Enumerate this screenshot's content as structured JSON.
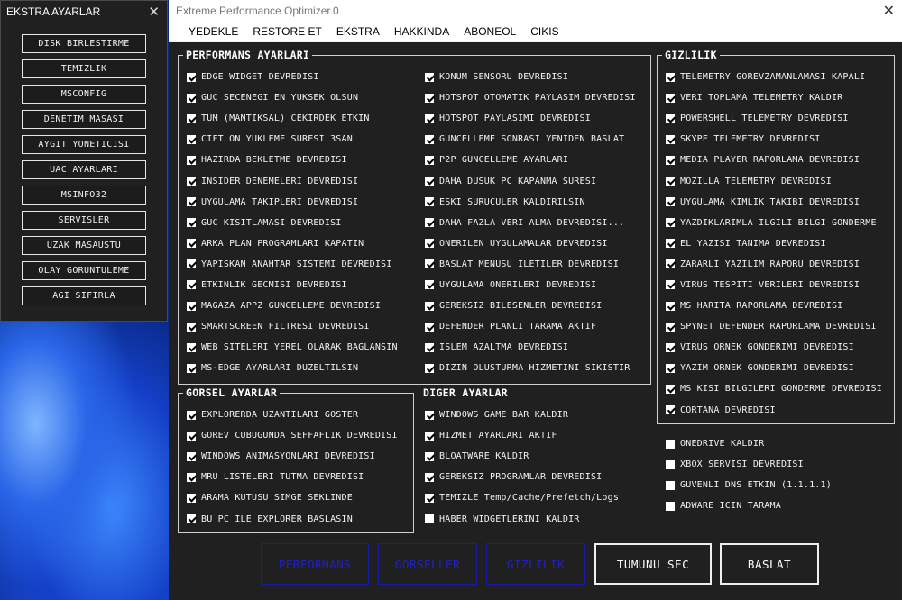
{
  "side_window": {
    "title": "EKSTRA AYARLAR",
    "close": "✕",
    "buttons": [
      "DISK BIRLESTIRME",
      "TEMIZLIK",
      "MSCONFIG",
      "DENETIM MASASI",
      "AYGIT YONETICISI",
      "UAC AYARLARI",
      "MSINFO32",
      "SERVISLER",
      "UZAK MASAUSTU",
      "OLAY GORUNTULEME",
      "AGI SIFIRLA"
    ]
  },
  "main_window": {
    "title": "Extreme Performance Optimizer.0",
    "close": "✕",
    "menu": [
      "YEDEKLE",
      "RESTORE ET",
      "EKSTRA",
      "HAKKINDA",
      "ABONEOL",
      "CIKIS"
    ]
  },
  "performans": {
    "title": "PERFORMANS AYARLARI",
    "col1": [
      {
        "label": "EDGE WIDGET DEVREDISI",
        "checked": true
      },
      {
        "label": "GUC SECENEGI EN YUKSEK OLSUN",
        "checked": true
      },
      {
        "label": "TUM (MANTIKSAL) CEKIRDEK ETKIN",
        "checked": true
      },
      {
        "label": "CIFT ON YUKLEME SURESI 3SAN",
        "checked": true
      },
      {
        "label": "HAZIRDA BEKLETME DEVREDISI",
        "checked": true
      },
      {
        "label": "INSIDER DENEMELERI DEVREDISI",
        "checked": true
      },
      {
        "label": "UYGULAMA TAKIPLERI DEVREDISI",
        "checked": true
      },
      {
        "label": "GUC KISITLAMASI DEVREDISI",
        "checked": true
      },
      {
        "label": "ARKA PLAN PROGRAMLARI KAPATIN",
        "checked": true
      },
      {
        "label": "YAPISKAN ANAHTAR SISTEMI DEVREDISI",
        "checked": true
      },
      {
        "label": "ETKINLIK GECMISI DEVREDISI",
        "checked": true
      },
      {
        "label": "MAGAZA APPZ GUNCELLEME DEVREDISI",
        "checked": true
      },
      {
        "label": "SMARTSCREEN FILTRESI DEVREDISI",
        "checked": true
      },
      {
        "label": "WEB SITELERI YEREL OLARAK BAGLANSIN",
        "checked": true
      },
      {
        "label": "MS-EDGE AYARLARI DUZELTILSIN",
        "checked": true
      }
    ],
    "col2": [
      {
        "label": "KONUM SENSORU DEVREDISI",
        "checked": true
      },
      {
        "label": "HOTSPOT OTOMATIK PAYLASIM DEVREDISI",
        "checked": true
      },
      {
        "label": "HOTSPOT PAYLASIMI DEVREDISI",
        "checked": true
      },
      {
        "label": "GUNCELLEME SONRASI YENIDEN BASLAT",
        "checked": true
      },
      {
        "label": "P2P GUNCELLEME AYARLARI",
        "checked": true
      },
      {
        "label": "DAHA DUSUK PC KAPANMA SURESI",
        "checked": true
      },
      {
        "label": "ESKI SURUCULER KALDIRILSIN",
        "checked": true
      },
      {
        "label": "DAHA FAZLA VERI ALMA DEVREDISI...",
        "checked": true
      },
      {
        "label": "ONERILEN UYGULAMALAR DEVREDISI",
        "checked": true
      },
      {
        "label": "BASLAT MENUSU ILETILER DEVREDISI",
        "checked": true
      },
      {
        "label": "UYGULAMA ONERILERI DEVREDISI",
        "checked": true
      },
      {
        "label": "GEREKSIZ BILESENLER DEVREDISI",
        "checked": true
      },
      {
        "label": "DEFENDER PLANLI TARAMA AKTIF",
        "checked": true
      },
      {
        "label": "ISLEM AZALTMA DEVREDISI",
        "checked": true
      },
      {
        "label": "DIZIN OLUSTURMA HIZMETINI SIKISTIR",
        "checked": true
      }
    ]
  },
  "gorsel": {
    "title": "GORSEL AYARLAR",
    "items": [
      {
        "label": "EXPLORERDA UZANTILARI GOSTER",
        "checked": true
      },
      {
        "label": "GOREV CUBUGUNDA SEFFAFLIK DEVREDISI",
        "checked": true
      },
      {
        "label": "WINDOWS ANIMASYONLARI DEVREDISI",
        "checked": true
      },
      {
        "label": "MRU LISTELERI TUTMA DEVREDISI",
        "checked": true
      },
      {
        "label": "ARAMA KUTUSU SIMGE SEKLINDE",
        "checked": true
      },
      {
        "label": "BU PC ILE EXPLORER BASLASIN",
        "checked": true
      }
    ]
  },
  "diger": {
    "title": "DIGER AYARLAR",
    "items": [
      {
        "label": "WINDOWS GAME BAR KALDIR",
        "checked": true
      },
      {
        "label": "HIZMET AYARLARI AKTIF",
        "checked": true
      },
      {
        "label": "BLOATWARE KALDIR",
        "checked": true
      },
      {
        "label": "GEREKSIZ PROGRAMLAR DEVREDISI",
        "checked": true
      },
      {
        "label": "TEMIZLE Temp/Cache/Prefetch/Logs",
        "checked": true
      },
      {
        "label": "HABER WIDGETLERINI KALDIR",
        "checked": false
      }
    ]
  },
  "gizlilik": {
    "title": "GIZLILIK",
    "items": [
      {
        "label": "TELEMETRY GOREVZAMANLAMASI KAPALI",
        "checked": true
      },
      {
        "label": "VERI TOPLAMA TELEMETRY KALDIR",
        "checked": true
      },
      {
        "label": "POWERSHELL TELEMETRY DEVREDISI",
        "checked": true
      },
      {
        "label": "SKYPE TELEMETRY DEVREDISI",
        "checked": true
      },
      {
        "label": "MEDIA PLAYER RAPORLAMA DEVREDISI",
        "checked": true
      },
      {
        "label": "MOZILLA TELEMETRY DEVREDISI",
        "checked": true
      },
      {
        "label": "UYGULAMA KIMLIK TAKIBI DEVREDISI",
        "checked": true
      },
      {
        "label": "YAZDIKLARIMLA ILGILI BILGI GONDERME",
        "checked": true
      },
      {
        "label": "EL YAZISI TANIMA DEVREDISI",
        "checked": true
      },
      {
        "label": "ZARARLI YAZILIM RAPORU DEVREDISI",
        "checked": true
      },
      {
        "label": "VIRUS TESPITI VERILERI DEVREDISI",
        "checked": true
      },
      {
        "label": "MS HARITA RAPORLAMA DEVREDISI",
        "checked": true
      },
      {
        "label": "SPYNET DEFENDER RAPORLAMA DEVREDISI",
        "checked": true
      },
      {
        "label": "VIRUS ORNEK GONDERIMI DEVREDISI",
        "checked": true
      },
      {
        "label": "YAZIM ORNEK GONDERIMI DEVREDISI",
        "checked": true
      },
      {
        "label": "MS KISI BILGILERI GONDERME DEVREDISI",
        "checked": true
      },
      {
        "label": "CORTANA DEVREDISI",
        "checked": true
      }
    ]
  },
  "extra": {
    "items": [
      {
        "label": "ONEDRIVE KALDIR",
        "checked": false
      },
      {
        "label": "XBOX SERVISI DEVREDISI",
        "checked": false
      },
      {
        "label": "GUVENLI DNS ETKIN (1.1.1.1)",
        "checked": false
      },
      {
        "label": "ADWARE ICIN TARAMA",
        "checked": false
      }
    ]
  },
  "buttons": {
    "performans": "PERFORMANS",
    "gorseller": "GORSELLER",
    "gizlilik": "GIZLILIK",
    "tumunu_sec": "TUMUNU SEC",
    "baslat": "BASLAT"
  },
  "colors": {
    "window_bg": "#202020",
    "dim_button": "#2020c8",
    "text": "#f2f2f2"
  }
}
